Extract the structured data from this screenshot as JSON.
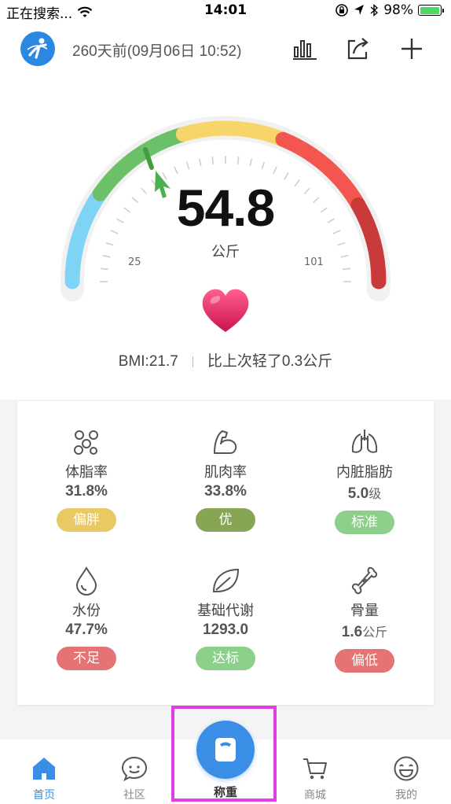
{
  "status_bar": {
    "carrier": "正在搜索...",
    "time": "14:01",
    "battery": "98%",
    "battery_level": 0.98
  },
  "header": {
    "last_measure": "260天前(09月06日 10:52)",
    "icons": [
      "chart-icon",
      "share-icon",
      "plus-icon"
    ]
  },
  "gauge": {
    "weight": "54.8",
    "unit": "公斤",
    "range_min": "25",
    "range_max": "101",
    "colors": [
      "#7fd3f5",
      "#6cc068",
      "#f8d56a",
      "#f2564e",
      "#c93a3a"
    ]
  },
  "summary": {
    "bmi": "BMI:21.7",
    "change": "比上次轻了0.3公斤"
  },
  "metrics": [
    {
      "icon": "body-fat-icon",
      "label": "体脂率",
      "value": "31.8%",
      "unit": "",
      "badge": "偏胖",
      "badge_color": "#e8c964"
    },
    {
      "icon": "muscle-icon",
      "label": "肌肉率",
      "value": "33.8%",
      "unit": "",
      "badge": "优",
      "badge_color": "#86a655"
    },
    {
      "icon": "lungs-icon",
      "label": "内脏脂肪",
      "value": "5.0",
      "unit": "级",
      "badge": "标准",
      "badge_color": "#8ccf8a"
    },
    {
      "icon": "water-drop-icon",
      "label": "水份",
      "value": "47.7%",
      "unit": "",
      "badge": "不足",
      "badge_color": "#e57373"
    },
    {
      "icon": "leaf-icon",
      "label": "基础代谢",
      "value": "1293.0",
      "unit": "",
      "badge": "达标",
      "badge_color": "#8ccf8a"
    },
    {
      "icon": "bone-icon",
      "label": "骨量",
      "value": "1.6",
      "unit": "公斤",
      "badge": "偏低",
      "badge_color": "#e57373"
    }
  ],
  "tabbar": {
    "tabs": [
      {
        "icon": "home-icon",
        "label": "首页"
      },
      {
        "icon": "chat-bubble-icon",
        "label": "社区"
      },
      {
        "icon": "scale-icon",
        "label": "称重"
      },
      {
        "icon": "cart-icon",
        "label": "商城"
      },
      {
        "icon": "smiley-icon",
        "label": "我的"
      }
    ],
    "accent": "#3a8ee6"
  }
}
